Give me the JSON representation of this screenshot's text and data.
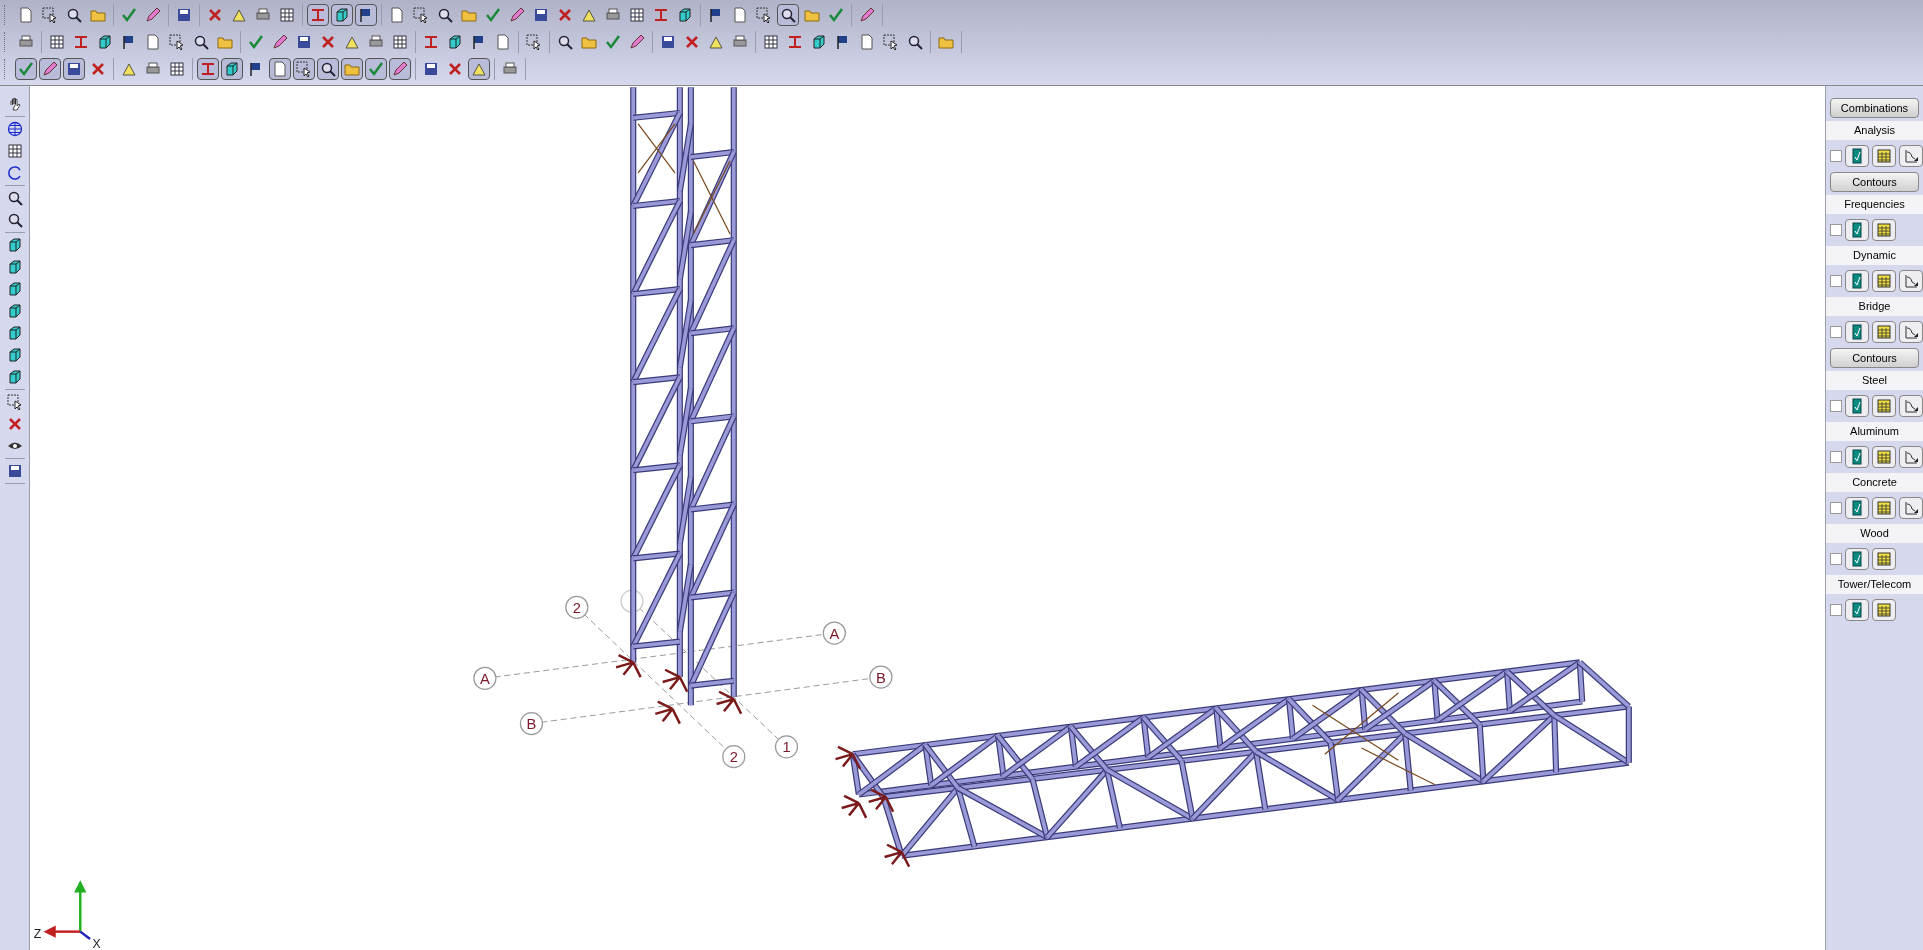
{
  "toolbars": [
    {
      "groups": [
        [
          {
            "pressed": false
          },
          {
            "pressed": false
          },
          {
            "pressed": false
          },
          {
            "pressed": false
          }
        ],
        [
          {
            "pressed": false
          },
          {
            "pressed": false
          }
        ],
        [
          {
            "pressed": false
          }
        ],
        [
          {
            "pressed": false
          },
          {
            "pressed": false
          },
          {
            "pressed": false
          },
          {
            "pressed": false
          }
        ],
        [
          {
            "pressed": true
          },
          {
            "pressed": true
          },
          {
            "pressed": true
          }
        ],
        [
          {
            "pressed": false
          },
          {
            "pressed": false
          },
          {
            "pressed": false
          },
          {
            "pressed": false
          },
          {
            "pressed": false
          },
          {
            "pressed": false
          },
          {
            "pressed": false
          },
          {
            "pressed": false
          },
          {
            "pressed": false
          },
          {
            "pressed": false
          },
          {
            "pressed": false
          },
          {
            "pressed": false
          },
          {
            "pressed": false
          }
        ],
        [
          {
            "pressed": false
          },
          {
            "pressed": false
          },
          {
            "pressed": false
          },
          {
            "pressed": true
          },
          {
            "pressed": false
          },
          {
            "pressed": false
          }
        ],
        [
          {
            "pressed": false
          }
        ]
      ]
    },
    {
      "groups": [
        [
          {
            "pressed": false
          }
        ],
        [
          {
            "pressed": false
          },
          {
            "pressed": false
          },
          {
            "pressed": false
          },
          {
            "pressed": false
          },
          {
            "pressed": false
          },
          {
            "pressed": false
          },
          {
            "pressed": false
          },
          {
            "pressed": false
          }
        ],
        [
          {
            "pressed": false
          },
          {
            "pressed": false
          },
          {
            "pressed": false
          },
          {
            "pressed": false
          },
          {
            "pressed": false
          },
          {
            "pressed": false
          },
          {
            "pressed": false
          }
        ],
        [
          {
            "pressed": false
          },
          {
            "pressed": false
          },
          {
            "pressed": false
          },
          {
            "pressed": false
          }
        ],
        [
          {
            "pressed": false
          }
        ],
        [
          {
            "pressed": false
          },
          {
            "pressed": false
          },
          {
            "pressed": false
          },
          {
            "pressed": false
          }
        ],
        [
          {
            "pressed": false
          },
          {
            "pressed": false
          },
          {
            "pressed": false
          },
          {
            "pressed": false
          }
        ],
        [
          {
            "pressed": false
          },
          {
            "pressed": false
          },
          {
            "pressed": false
          },
          {
            "pressed": false
          },
          {
            "pressed": false
          },
          {
            "pressed": false
          },
          {
            "pressed": false
          }
        ],
        [
          {
            "pressed": false
          }
        ]
      ]
    },
    {
      "groups": [
        [
          {
            "pressed": true
          },
          {
            "pressed": true
          },
          {
            "pressed": true
          },
          {
            "pressed": false
          }
        ],
        [
          {
            "pressed": false
          },
          {
            "pressed": false
          },
          {
            "pressed": false
          }
        ],
        [
          {
            "pressed": true
          },
          {
            "pressed": true
          },
          {
            "pressed": false
          },
          {
            "pressed": true
          },
          {
            "pressed": true
          },
          {
            "pressed": true
          },
          {
            "pressed": true
          },
          {
            "pressed": true
          },
          {
            "pressed": true
          }
        ],
        [
          {
            "pressed": false
          },
          {
            "pressed": false
          },
          {
            "pressed": true
          }
        ],
        [
          {
            "pressed": false
          }
        ]
      ]
    }
  ],
  "panel": [
    {
      "kind": "button",
      "label": "Combinations"
    },
    {
      "kind": "header",
      "label": "Analysis"
    },
    {
      "kind": "tools",
      "checked": false,
      "tools": [
        {
          "kind": "report"
        },
        {
          "kind": "table"
        },
        {
          "kind": "plot"
        }
      ]
    },
    {
      "kind": "button",
      "label": "Contours"
    },
    {
      "kind": "header",
      "label": "Frequencies"
    },
    {
      "kind": "tools",
      "checked": false,
      "tools": [
        {
          "kind": "report"
        },
        {
          "kind": "table"
        }
      ]
    },
    {
      "kind": "header",
      "label": "Dynamic"
    },
    {
      "kind": "tools",
      "checked": false,
      "tools": [
        {
          "kind": "report"
        },
        {
          "kind": "table"
        },
        {
          "kind": "plot"
        }
      ]
    },
    {
      "kind": "header",
      "label": "Bridge"
    },
    {
      "kind": "tools",
      "checked": false,
      "tools": [
        {
          "kind": "report"
        },
        {
          "kind": "table"
        },
        {
          "kind": "plot"
        }
      ]
    },
    {
      "kind": "button",
      "label": "Contours"
    },
    {
      "kind": "header",
      "label": "Steel"
    },
    {
      "kind": "tools",
      "checked": false,
      "tools": [
        {
          "kind": "report"
        },
        {
          "kind": "table"
        },
        {
          "kind": "plot"
        }
      ]
    },
    {
      "kind": "header",
      "label": "Aluminum"
    },
    {
      "kind": "tools",
      "checked": false,
      "tools": [
        {
          "kind": "report"
        },
        {
          "kind": "table"
        },
        {
          "kind": "plot"
        }
      ]
    },
    {
      "kind": "header",
      "label": "Concrete"
    },
    {
      "kind": "tools",
      "checked": false,
      "tools": [
        {
          "kind": "report"
        },
        {
          "kind": "table"
        },
        {
          "kind": "plot"
        }
      ]
    },
    {
      "kind": "header",
      "label": "Wood"
    },
    {
      "kind": "tools",
      "checked": false,
      "tools": [
        {
          "kind": "report"
        },
        {
          "kind": "table"
        }
      ]
    },
    {
      "kind": "header",
      "label": "Tower/Telecom"
    },
    {
      "kind": "tools",
      "checked": false,
      "tools": [
        {
          "kind": "report"
        },
        {
          "kind": "table"
        }
      ]
    }
  ],
  "canvas": {
    "gridline_labels": [
      "2",
      "A",
      "B",
      "A",
      "B",
      "1",
      "2"
    ],
    "axis_labels": [
      "Z",
      "X"
    ]
  }
}
